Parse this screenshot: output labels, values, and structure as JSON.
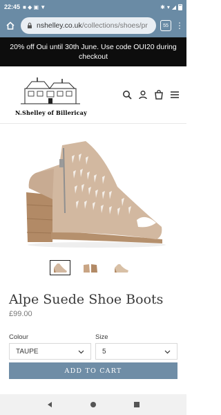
{
  "status_bar": {
    "time": "22:45"
  },
  "browser": {
    "url_domain": "nshelley.co.uk",
    "url_path": "/collections/shoes/pr",
    "tab_count": "55"
  },
  "promo_banner": {
    "text": "20% off Oui until 30th June. Use code OUI20 during checkout"
  },
  "logo": {
    "text": "N.Shelley of Billericay"
  },
  "product": {
    "title": "Alpe Suede Shoe Boots",
    "price": "£99.00",
    "thumbnails": [
      "side view",
      "pair view",
      "angle view"
    ]
  },
  "options": {
    "colour_label": "Colour",
    "colour_value": "TAUPE",
    "size_label": "Size",
    "size_value": "5"
  },
  "add_to_cart_label": "ADD TO CART",
  "colors": {
    "browser_chrome": "#6a8ba5",
    "banner_bg": "#0d0d0d",
    "button_bg": "#6f8da6",
    "shoe": "#d2b8a0",
    "heel": "#b28a66"
  }
}
